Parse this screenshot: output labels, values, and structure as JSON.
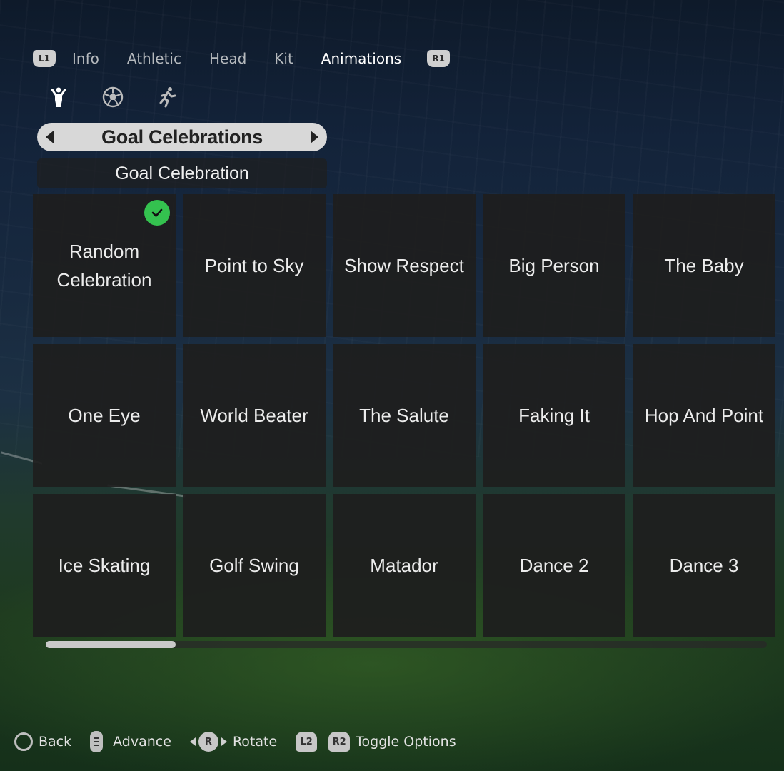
{
  "tabs": {
    "left_shoulder": "L1",
    "right_shoulder": "R1",
    "items": [
      {
        "label": "Info",
        "active": false
      },
      {
        "label": "Athletic",
        "active": false
      },
      {
        "label": "Head",
        "active": false
      },
      {
        "label": "Kit",
        "active": false
      },
      {
        "label": "Animations",
        "active": true
      }
    ]
  },
  "category_icons": [
    "celebration-icon",
    "ball-icon",
    "running-icon"
  ],
  "selector": {
    "label": "Goal Celebrations"
  },
  "subheader": {
    "label": "Goal Celebration"
  },
  "tiles": [
    {
      "label": "Random Celebration",
      "selected": true
    },
    {
      "label": "Point to Sky"
    },
    {
      "label": "Show Respect"
    },
    {
      "label": "Big Person"
    },
    {
      "label": "The Baby"
    },
    {
      "label": "One Eye"
    },
    {
      "label": "World Beater"
    },
    {
      "label": "The Salute"
    },
    {
      "label": "Faking It"
    },
    {
      "label": "Hop And Point"
    },
    {
      "label": "Ice Skating"
    },
    {
      "label": "Golf Swing"
    },
    {
      "label": "Matador"
    },
    {
      "label": "Dance 2"
    },
    {
      "label": "Dance 3"
    }
  ],
  "scroll": {
    "position_fraction": 0.0,
    "visible_fraction": 0.18
  },
  "footer": {
    "back": {
      "button": "circle-button",
      "label": "Back"
    },
    "advance": {
      "button": "touchpad-button",
      "label": "Advance"
    },
    "rotate": {
      "button": "R",
      "label": "Rotate"
    },
    "toggle": {
      "buttons": [
        "L2",
        "R2"
      ],
      "label": "Toggle Options"
    }
  },
  "colors": {
    "check": "#34c24f",
    "selector_bg": "#d8d8d8",
    "tile_bg": "#1e1e1e"
  }
}
